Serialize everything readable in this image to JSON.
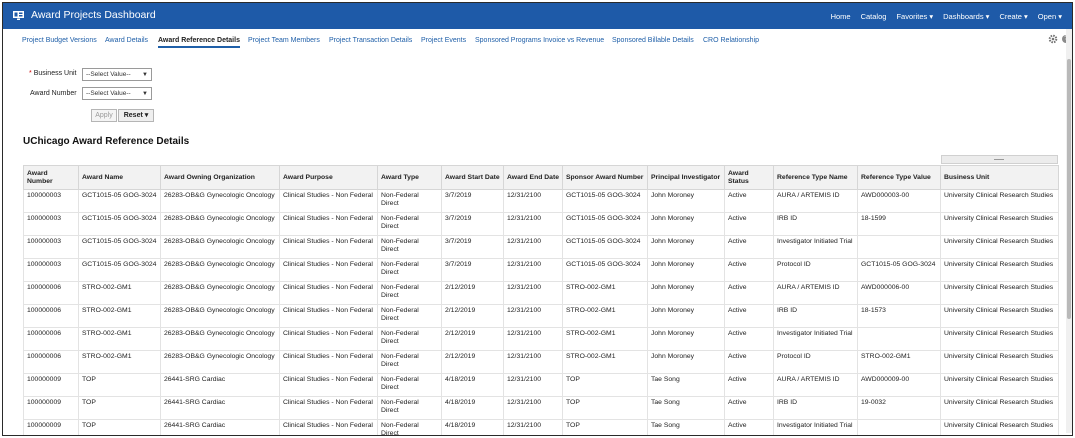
{
  "app": {
    "title": "Award Projects Dashboard"
  },
  "topnav": {
    "home": "Home",
    "catalog": "Catalog",
    "favorites": "Favorites ▾",
    "dashboards": "Dashboards ▾",
    "create": "Create ▾",
    "open": "Open ▾"
  },
  "tabs": [
    "Project Budget Versions",
    "Award Details",
    "Award Reference Details",
    "Project Team Members",
    "Project Transaction Details",
    "Project Events",
    "Sponsored Programs Invoice vs Revenue",
    "Sponsored Billable Details",
    "CRO Relationship"
  ],
  "prompts": {
    "business_unit_label": "Business Unit",
    "business_unit_value": "--Select Value--",
    "award_number_label": "Award Number",
    "award_number_value": "--Select Value--",
    "required_mark": "*",
    "apply": "Apply",
    "reset": "Reset ▾"
  },
  "section_title": "UChicago Award Reference Details",
  "table": {
    "columns": [
      "Award Number",
      "Award Name",
      "Award Owning Organization",
      "Award Purpose",
      "Award Type",
      "Award Start Date",
      "Award End Date",
      "Sponsor Award Number",
      "Principal Investigator",
      "Award Status",
      "Reference Type Name",
      "Reference Type Value",
      "Business Unit"
    ],
    "rows": [
      [
        "100000003",
        "GCT1015-05 GOG-3024",
        "26283-OB&G Gynecologic Oncology",
        "Clinical Studies - Non Federal",
        "Non-Federal Direct",
        "3/7/2019",
        "12/31/2100",
        "GCT1015-05 GOG-3024",
        "John Moroney",
        "Active",
        "AURA / ARTEMIS ID",
        "AWD000003-00",
        "University Clinical Research Studies"
      ],
      [
        "100000003",
        "GCT1015-05 GOG-3024",
        "26283-OB&G Gynecologic Oncology",
        "Clinical Studies - Non Federal",
        "Non-Federal Direct",
        "3/7/2019",
        "12/31/2100",
        "GCT1015-05 GOG-3024",
        "John Moroney",
        "Active",
        "IRB ID",
        "18-1599",
        "University Clinical Research Studies"
      ],
      [
        "100000003",
        "GCT1015-05 GOG-3024",
        "26283-OB&G Gynecologic Oncology",
        "Clinical Studies - Non Federal",
        "Non-Federal Direct",
        "3/7/2019",
        "12/31/2100",
        "GCT1015-05 GOG-3024",
        "John Moroney",
        "Active",
        "Investigator Initiated Trial",
        "",
        "University Clinical Research Studies"
      ],
      [
        "100000003",
        "GCT1015-05 GOG-3024",
        "26283-OB&G Gynecologic Oncology",
        "Clinical Studies - Non Federal",
        "Non-Federal Direct",
        "3/7/2019",
        "12/31/2100",
        "GCT1015-05 GOG-3024",
        "John Moroney",
        "Active",
        "Protocol ID",
        "GCT1015-05 GOG-3024",
        "University Clinical Research Studies"
      ],
      [
        "100000006",
        "STRO-002-GM1",
        "26283-OB&G Gynecologic Oncology",
        "Clinical Studies - Non Federal",
        "Non-Federal Direct",
        "2/12/2019",
        "12/31/2100",
        "STRO-002-GM1",
        "John Moroney",
        "Active",
        "AURA / ARTEMIS ID",
        "AWD000006-00",
        "University Clinical Research Studies"
      ],
      [
        "100000006",
        "STRO-002-GM1",
        "26283-OB&G Gynecologic Oncology",
        "Clinical Studies - Non Federal",
        "Non-Federal Direct",
        "2/12/2019",
        "12/31/2100",
        "STRO-002-GM1",
        "John Moroney",
        "Active",
        "IRB ID",
        "18-1573",
        "University Clinical Research Studies"
      ],
      [
        "100000006",
        "STRO-002-GM1",
        "26283-OB&G Gynecologic Oncology",
        "Clinical Studies - Non Federal",
        "Non-Federal Direct",
        "2/12/2019",
        "12/31/2100",
        "STRO-002-GM1",
        "John Moroney",
        "Active",
        "Investigator Initiated Trial",
        "",
        "University Clinical Research Studies"
      ],
      [
        "100000006",
        "STRO-002-GM1",
        "26283-OB&G Gynecologic Oncology",
        "Clinical Studies - Non Federal",
        "Non-Federal Direct",
        "2/12/2019",
        "12/31/2100",
        "STRO-002-GM1",
        "John Moroney",
        "Active",
        "Protocol ID",
        "STRO-002-GM1",
        "University Clinical Research Studies"
      ],
      [
        "100000009",
        "TOP",
        "26441-SRG Cardiac",
        "Clinical Studies - Non Federal",
        "Non-Federal Direct",
        "4/18/2019",
        "12/31/2100",
        "TOP",
        "Tae Song",
        "Active",
        "AURA / ARTEMIS ID",
        "AWD000009-00",
        "University Clinical Research Studies"
      ],
      [
        "100000009",
        "TOP",
        "26441-SRG Cardiac",
        "Clinical Studies - Non Federal",
        "Non-Federal Direct",
        "4/18/2019",
        "12/31/2100",
        "TOP",
        "Tae Song",
        "Active",
        "IRB ID",
        "19-0032",
        "University Clinical Research Studies"
      ],
      [
        "100000009",
        "TOP",
        "26441-SRG Cardiac",
        "Clinical Studies - Non Federal",
        "Non-Federal Direct",
        "4/18/2019",
        "12/31/2100",
        "TOP",
        "Tae Song",
        "Active",
        "Investigator Initiated Trial",
        "",
        "University Clinical Research Studies"
      ]
    ]
  },
  "icons": {
    "app": "dashboard-icon",
    "settings": "gear-icon",
    "help": "help-icon"
  },
  "colors": {
    "header_bg": "#1e5aa8",
    "link": "#1f5fa8"
  }
}
